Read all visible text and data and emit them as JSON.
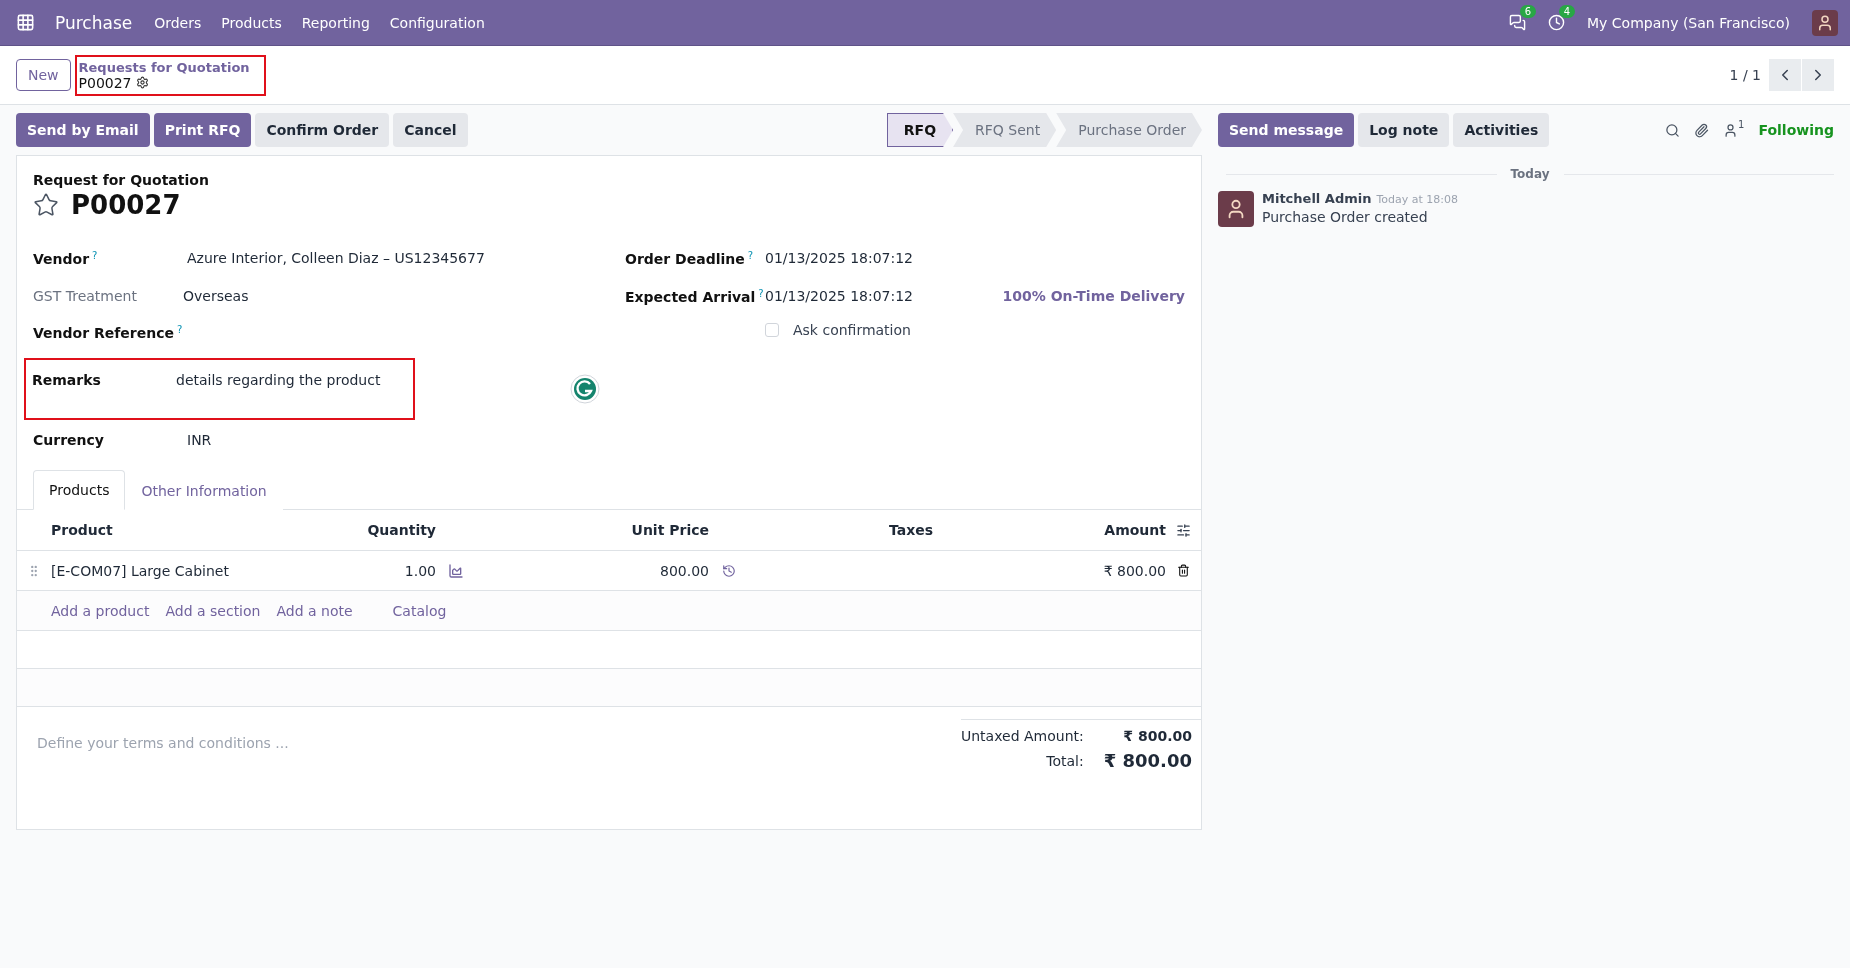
{
  "navbar": {
    "app_name": "Purchase",
    "menu": [
      "Orders",
      "Products",
      "Reporting",
      "Configuration"
    ],
    "messages_count": "6",
    "activities_count": "4",
    "company": "My Company (San Francisco)"
  },
  "control_panel": {
    "new_button": "New",
    "breadcrumb": {
      "parent": "Requests for Quotation",
      "current": "P00027",
      "highlighted": true
    },
    "pager": "1 / 1"
  },
  "actions": [
    {
      "label": "Send by Email",
      "kind": "primary"
    },
    {
      "label": "Print RFQ",
      "kind": "primary"
    },
    {
      "label": "Confirm Order",
      "kind": "secondary"
    },
    {
      "label": "Cancel",
      "kind": "secondary"
    }
  ],
  "statusbar": [
    {
      "label": "RFQ",
      "selected": true
    },
    {
      "label": "RFQ Sent",
      "selected": false
    },
    {
      "label": "Purchase Order",
      "selected": false
    }
  ],
  "form": {
    "caption": "Request for Quotation",
    "name": "P00027",
    "starred": false,
    "left_fields": [
      {
        "label": "Vendor",
        "help": "?",
        "value": "Azure Interior, Colleen Diaz – US12345677",
        "muted": false,
        "highlighted": false
      },
      {
        "label": "GST Treatment",
        "value": "Overseas",
        "muted": true,
        "highlighted": false
      },
      {
        "label": "Vendor Reference",
        "help": "?",
        "muted": false,
        "highlighted": false
      },
      {
        "label": "Remarks",
        "value": "details regarding the product",
        "muted": false,
        "highlighted": true
      },
      {
        "label": "Currency",
        "value": "INR",
        "muted": false,
        "highlighted": false
      }
    ],
    "right_fields": [
      {
        "label": "Order Deadline",
        "help": "?",
        "value": "01/13/2025 18:07:12"
      },
      {
        "label": "Expected Arrival",
        "help": "?",
        "value": "01/13/2025 18:07:12",
        "extra": "100% On-Time Delivery"
      }
    ],
    "ask_confirmation": {
      "label": "Ask confirmation",
      "checked": false
    },
    "tabs": [
      {
        "label": "Products",
        "selected": true
      },
      {
        "label": "Other Information",
        "selected": false
      }
    ],
    "table": {
      "columns": [
        "Product",
        "Quantity",
        "Unit Price",
        "Taxes",
        "Amount"
      ],
      "rows": [
        {
          "product": "[E-COM07] Large Cabinet",
          "quantity": "1.00",
          "unit_price": "800.00",
          "taxes": "",
          "amount": "₹ 800.00"
        }
      ],
      "add_links": [
        "Add a product",
        "Add a section",
        "Add a note",
        "Catalog"
      ]
    },
    "terms_placeholder": "Define your terms and conditions ...",
    "totals": [
      {
        "label": "Untaxed Amount:",
        "value": "₹ 800.00",
        "grand": false
      },
      {
        "label": "Total:",
        "value": "₹ 800.00",
        "grand": true
      }
    ]
  },
  "chatter": {
    "buttons": [
      {
        "label": "Send message",
        "kind": "primary"
      },
      {
        "label": "Log note",
        "kind": "secondary"
      },
      {
        "label": "Activities",
        "kind": "secondary"
      }
    ],
    "follower_count": "1",
    "follow_label": "Following",
    "date_label": "Today",
    "messages": [
      {
        "author": "Mitchell Admin",
        "time": "Today at 18:08",
        "body": "Purchase Order created"
      }
    ]
  }
}
